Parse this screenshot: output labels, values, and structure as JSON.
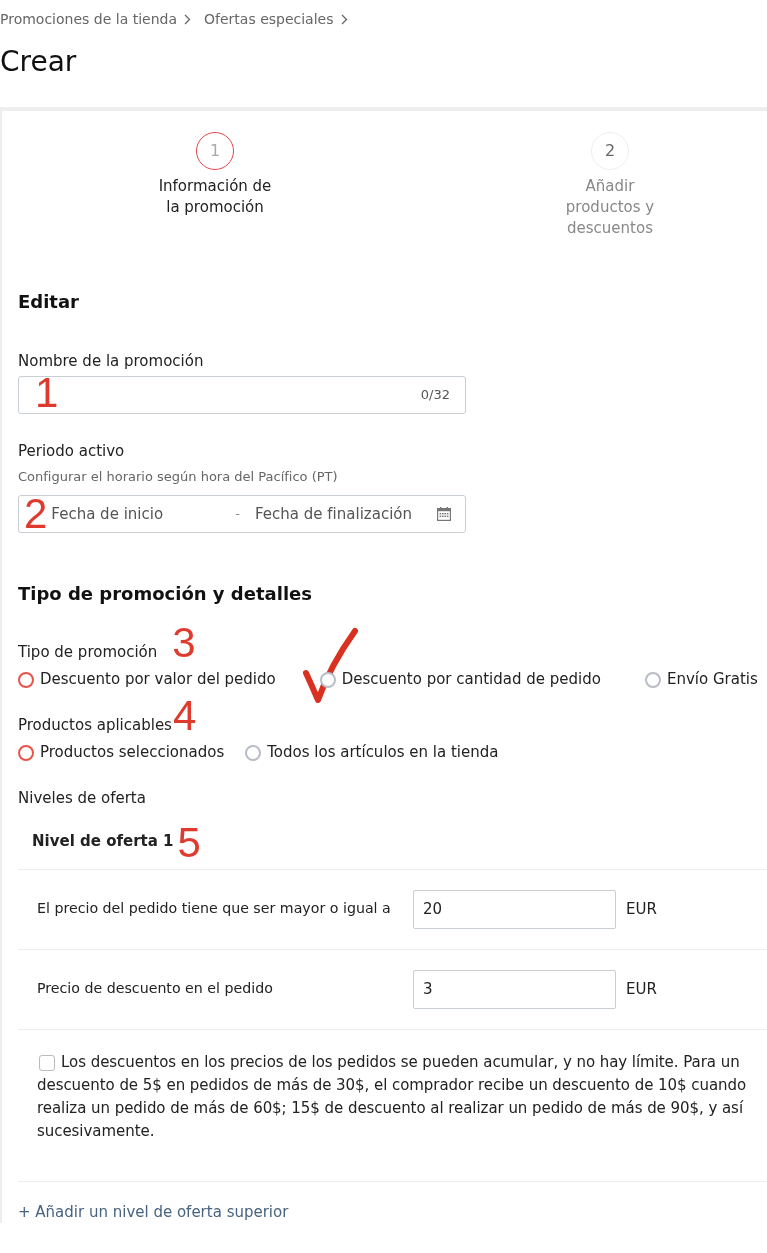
{
  "breadcrumb": [
    {
      "label": "Promociones de la tienda"
    },
    {
      "label": "Ofertas especiales"
    }
  ],
  "title": "Crear",
  "steps": [
    {
      "number": "1",
      "label": "Información de la promoción",
      "selected": true
    },
    {
      "number": "2",
      "label": "Añadir productos y descuentos",
      "selected": false
    }
  ],
  "edit_section": {
    "heading": "Editar",
    "name_field": {
      "label": "Nombre de la promoción",
      "counter": "0/32",
      "annotation": "1"
    },
    "period_field": {
      "label": "Periodo activo",
      "hint": "Configurar el horario según hora del Pacífico (PT)",
      "start": {
        "placeholder": "Fecha de inicio"
      },
      "separator": "-",
      "end": {
        "placeholder": "Fecha de finalización"
      },
      "annotation": "2"
    }
  },
  "details_section": {
    "heading": "Tipo de promoción y detalles",
    "option_groups": [
      {
        "label": "Tipo de promoción",
        "annotation": "3",
        "options": [
          {
            "label": "Descuento por valor del pedido",
            "selected": false,
            "color": "#e8534a",
            "marked": false
          },
          {
            "label": "Descuento por cantidad de pedido",
            "selected": false,
            "color": "#b9bdc5",
            "marked": true
          },
          {
            "label": "Envío Gratis",
            "selected": false,
            "color": "#b9bdc5",
            "marked": false
          }
        ]
      },
      {
        "label": "Productos aplicables",
        "annotation": "4",
        "options": [
          {
            "label": "Productos seleccionados",
            "selected": false,
            "color": "#e8534a",
            "marked": false
          },
          {
            "label": "Todos los artículos en la tienda",
            "selected": false,
            "color": "#b9bdc5",
            "marked": false
          }
        ]
      }
    ],
    "tiers": {
      "label": "Niveles de oferta",
      "items": [
        {
          "title": "Nivel de oferta 1",
          "annotation": "5",
          "rows": [
            {
              "label": "El precio del pedido tiene que ser mayor o igual a",
              "value": "20",
              "unit": "EUR"
            },
            {
              "label": "Precio de descuento en el pedido",
              "value": "3",
              "unit": "EUR"
            }
          ],
          "stackable": {
            "label": "Los descuentos en los precios de los pedidos se pueden acumular, y no hay límite. Para un descuento de 5$ en pedidos de más de 30$, el comprador recibe un descuento de 10$ cuando realiza un pedido de más de 60$; 15$ de descuento al realizar un pedido de más de 90$, y así sucesivamente.",
            "checked": false
          }
        }
      ],
      "add_link": "+ Añadir un nivel de oferta superior"
    }
  }
}
